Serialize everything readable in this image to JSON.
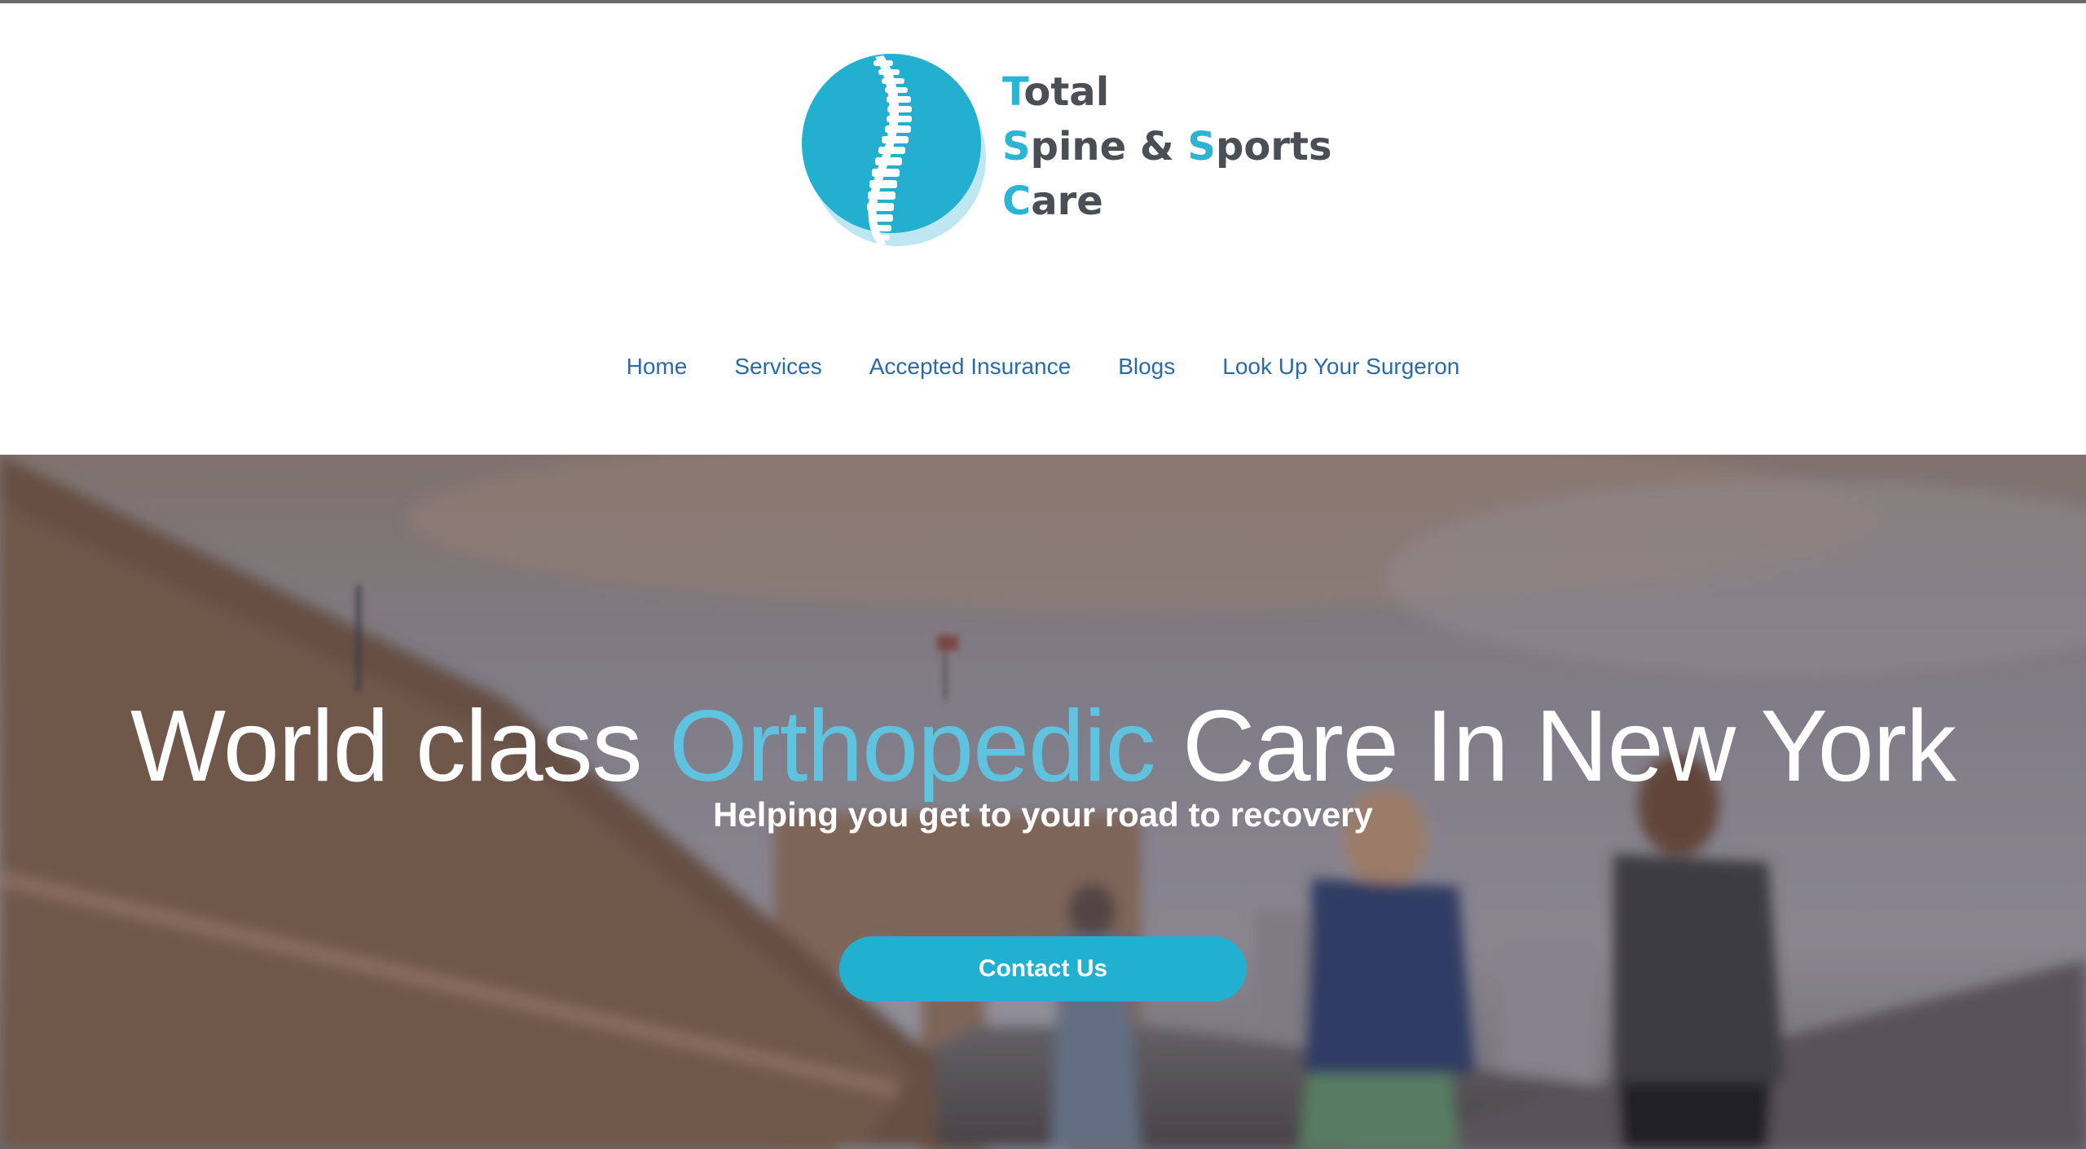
{
  "brand": {
    "logo_icon": "spine-icon",
    "line1_initial": "T",
    "line1_rest": "otal",
    "line2_initial1": "S",
    "line2_mid": "pine & ",
    "line2_initial2": "S",
    "line2_rest": "ports",
    "line3_initial": "C",
    "line3_rest": "are",
    "accent_color": "#2db3d3",
    "text_color": "#4a4f55"
  },
  "nav": {
    "items": [
      {
        "label": "Home"
      },
      {
        "label": "Services"
      },
      {
        "label": "Accepted Insurance"
      },
      {
        "label": "Blogs"
      },
      {
        "label": "Look Up Your Surgeron"
      }
    ],
    "link_color": "#2a6aa8"
  },
  "hero": {
    "title_before": "World class ",
    "title_accent": "Orthopedic",
    "title_after": " Care In New York",
    "subtitle": "Helping you get to your road to recovery",
    "cta_label": "Contact Us",
    "cta_color": "#22b0d0",
    "title_accent_color": "#5fc3e0"
  }
}
